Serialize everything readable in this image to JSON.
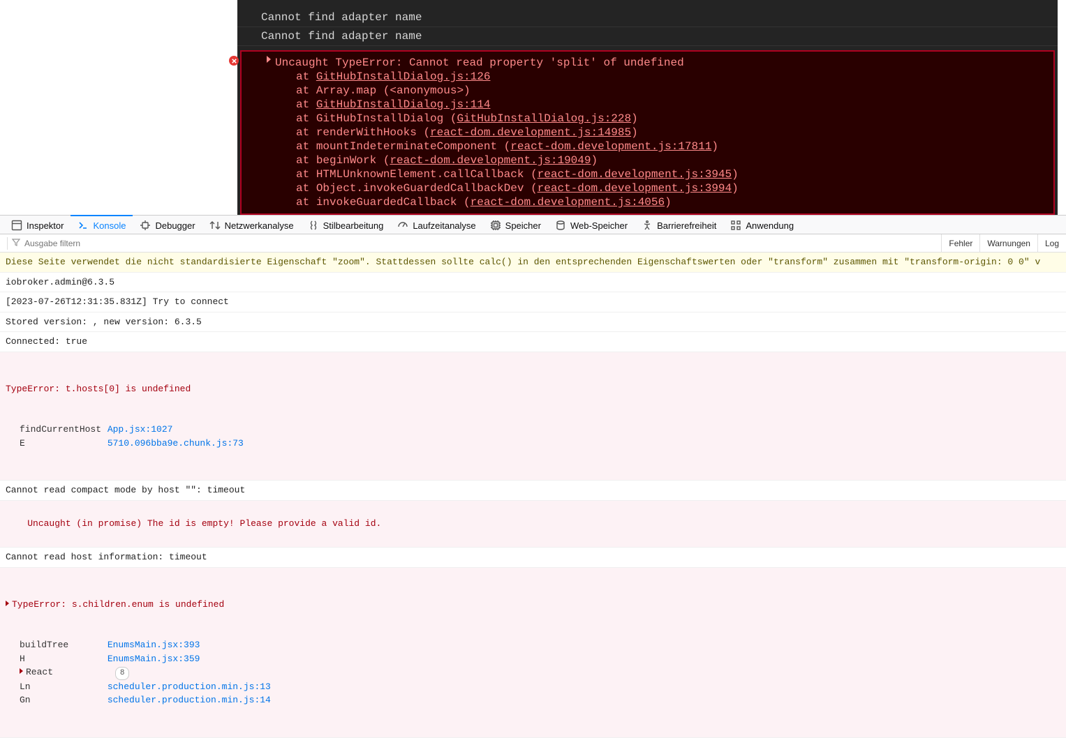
{
  "page_console": {
    "loglines": [
      "Cannot find adapter name",
      "Cannot find adapter name"
    ],
    "error_head": "Uncaught TypeError: Cannot read property 'split' of undefined",
    "stack": [
      {
        "prefix": "at ",
        "text": "",
        "link": "GitHubInstallDialog.js:126"
      },
      {
        "prefix": "at ",
        "text": "Array.map (<anonymous>)",
        "link": ""
      },
      {
        "prefix": "at ",
        "text": "",
        "link": "GitHubInstallDialog.js:114"
      },
      {
        "prefix": "at ",
        "text": "GitHubInstallDialog (",
        "link": "GitHubInstallDialog.js:228",
        "suffix": ")"
      },
      {
        "prefix": "at ",
        "text": "renderWithHooks (",
        "link": "react-dom.development.js:14985",
        "suffix": ")"
      },
      {
        "prefix": "at ",
        "text": "mountIndeterminateComponent (",
        "link": "react-dom.development.js:17811",
        "suffix": ")"
      },
      {
        "prefix": "at ",
        "text": "beginWork (",
        "link": "react-dom.development.js:19049",
        "suffix": ")"
      },
      {
        "prefix": "at ",
        "text": "HTMLUnknownElement.callCallback (",
        "link": "react-dom.development.js:3945",
        "suffix": ")"
      },
      {
        "prefix": "at ",
        "text": "Object.invokeGuardedCallbackDev (",
        "link": "react-dom.development.js:3994",
        "suffix": ")"
      },
      {
        "prefix": "at ",
        "text": "invokeGuardedCallback (",
        "link": "react-dom.development.js:4056",
        "suffix": ")"
      }
    ]
  },
  "devtools": {
    "tools": {
      "inspector": "Inspektor",
      "console": "Konsole",
      "debugger": "Debugger",
      "network": "Netzwerkanalyse",
      "style": "Stilbearbeitung",
      "performance": "Laufzeitanalyse",
      "memory": "Speicher",
      "storage": "Web-Speicher",
      "accessibility": "Barrierefreiheit",
      "application": "Anwendung"
    }
  },
  "filter": {
    "placeholder": "Ausgabe filtern",
    "buttons": {
      "fehler": "Fehler",
      "warnungen": "Warnungen",
      "log": "Log"
    }
  },
  "console": {
    "warn_zoom": "Diese Seite verwendet die nicht standardisierte Eigenschaft \"zoom\". Stattdessen sollte calc() in den entsprechenden Eigenschaftswerten oder \"transform\" zusammen mit \"transform-origin: 0 0\" v",
    "version": "iobroker.admin@6.3.5",
    "connect": "[2023-07-26T12:31:35.831Z] Try to connect",
    "stored": "Stored version: , new version: 6.3.5",
    "connected": "Connected: true",
    "err1_head": "TypeError: t.hosts[0] is undefined",
    "err1_trace": [
      {
        "fn": "findCurrentHost",
        "src": "App.jsx:1027"
      },
      {
        "fn": "E",
        "src": "5710.096bba9e.chunk.js:73"
      }
    ],
    "compact_timeout": "Cannot read compact mode by host \"\": timeout",
    "err2": "Uncaught (in promise) The id is empty! Please provide a valid id.",
    "hostinfo_timeout": "Cannot read host information: timeout",
    "err3_head": "TypeError: s.children.enum is undefined",
    "err3_trace": [
      {
        "fn": "buildTree",
        "src": "EnumsMain.jsx:393"
      },
      {
        "fn": "H",
        "src": "EnumsMain.jsx:359"
      },
      {
        "fn": "React",
        "badge": "8",
        "caret": true
      },
      {
        "fn": "Ln",
        "src": "scheduler.production.min.js:13"
      },
      {
        "fn": "Gn",
        "src": "scheduler.production.min.js:14"
      }
    ]
  }
}
